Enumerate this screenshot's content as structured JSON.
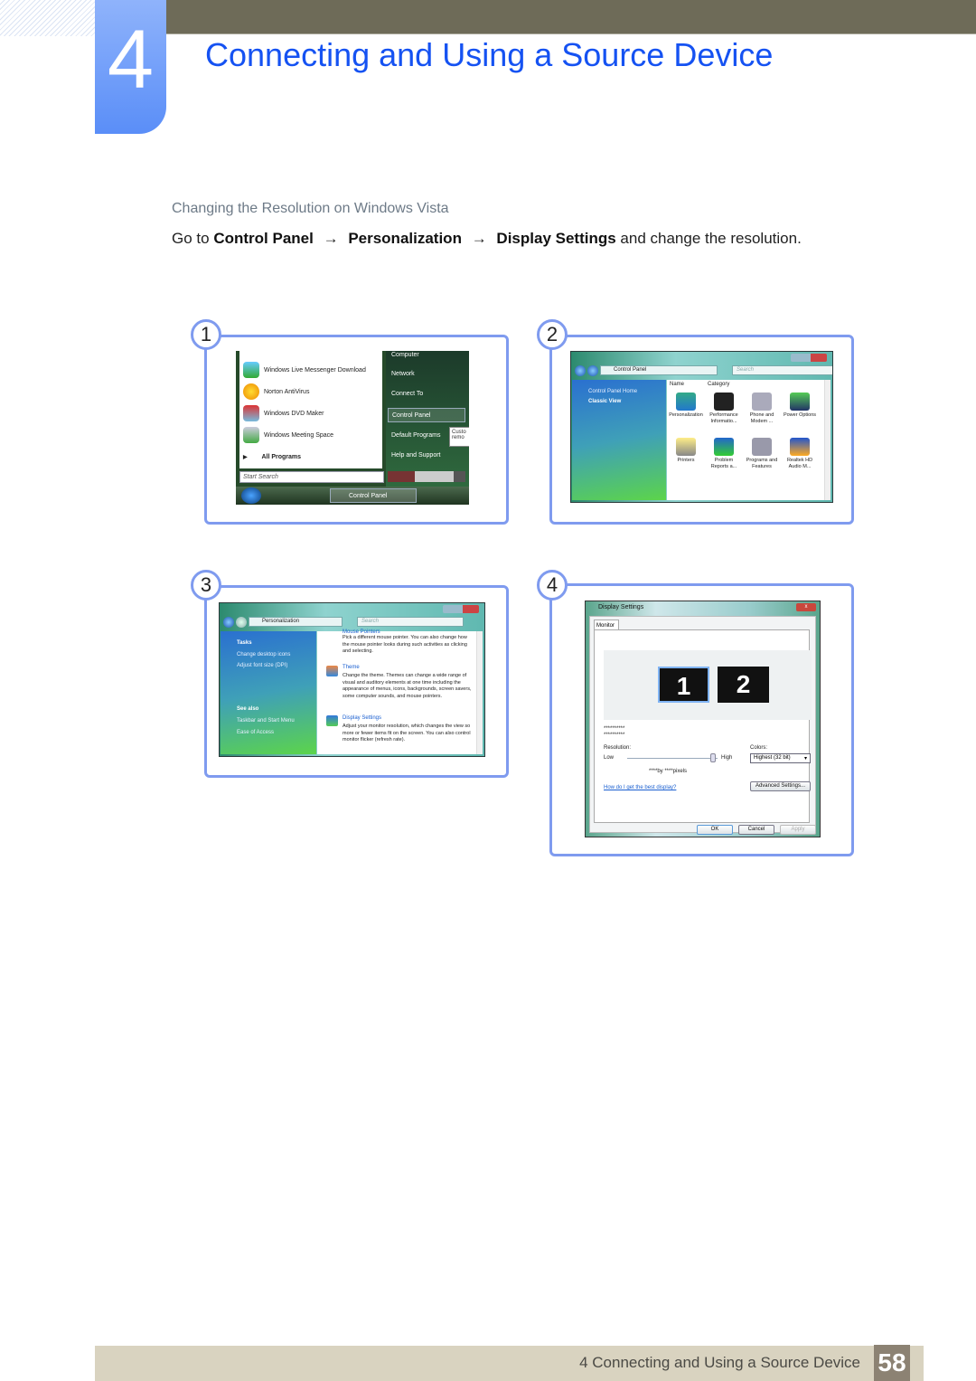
{
  "header": {
    "chapter_number": "4",
    "chapter_title": "Connecting and Using a Source Device"
  },
  "section": {
    "subheading": "Changing the Resolution on Windows Vista",
    "instruction": {
      "prefix": "Go to",
      "step1": "Control Panel",
      "arrow": "→",
      "step2": "Personalization",
      "step3": "Display Settings",
      "suffix": "and change the resolution."
    }
  },
  "steps": [
    {
      "badge": "1",
      "start_menu": {
        "left_items": [
          "Windows Live Messenger Download",
          "Norton AntiVirus",
          "Windows DVD Maker",
          "Windows Meeting Space"
        ],
        "all_programs": "All Programs",
        "right_items": [
          "Computer",
          "Network",
          "Connect To",
          "Control Panel",
          "Default Programs",
          "Help and Support"
        ],
        "selected_right_item": "Control Panel",
        "tooltip": "Custo remo",
        "search_placeholder": "Start Search",
        "taskbar_item": "Control Panel"
      }
    },
    {
      "badge": "2",
      "window": {
        "address": "Control Panel",
        "search_placeholder": "Search",
        "side_links": [
          "Control Panel Home",
          "Classic View"
        ],
        "columns": [
          "Name",
          "Category"
        ],
        "items": [
          "Personalization",
          "Performance Informatio...",
          "Phone and Modem ...",
          "Power Options",
          "Printers",
          "Problem Reports a...",
          "Programs and Features",
          "Realtek HD Audio M..."
        ]
      }
    },
    {
      "badge": "3",
      "window": {
        "address": "Personalization",
        "search_placeholder": "Search",
        "tasks_heading": "Tasks",
        "tasks": [
          "Change desktop icons",
          "Adjust font size (DPI)"
        ],
        "see_also_heading": "See also",
        "see_also": [
          "Taskbar and Start Menu",
          "Ease of Access"
        ],
        "entries": [
          {
            "title": "Mouse Pointers",
            "desc": "Pick a different mouse pointer. You can also change how the mouse pointer looks during such activities as clicking and selecting."
          },
          {
            "title": "Theme",
            "desc": "Change the theme. Themes can change a wide range of visual and auditory elements at one time including the appearance of menus, icons, backgrounds, screen savers, some computer sounds, and mouse pointers."
          },
          {
            "title": "Display Settings",
            "desc": "Adjust your monitor resolution, which changes the view so more or fewer items fit on the screen. You can also control monitor flicker (refresh rate)."
          }
        ]
      }
    },
    {
      "badge": "4",
      "dialog": {
        "title": "Display Settings",
        "close": "x",
        "tab": "Monitor",
        "monitors": [
          "1",
          "2"
        ],
        "monitor_name_line1": "**********",
        "monitor_name_line2": "**********",
        "resolution_label": "Resolution:",
        "low": "Low",
        "high": "High",
        "resolution_value": "****by ****pixels",
        "resolution_slider_fraction": 0.95,
        "colors_label": "Colors:",
        "colors_value": "Highest (32 bit)",
        "help_link": "How do I get the best display?",
        "advanced_button": "Advanced Settings...",
        "ok": "OK",
        "cancel": "Cancel",
        "apply": "Apply"
      }
    }
  ],
  "footer": {
    "text": "4 Connecting and Using a Source Device",
    "page": "58"
  },
  "colors": {
    "accent_blue": "#1552f2",
    "frame_blue": "#7f9bef",
    "topbar": "#6e6b58",
    "footer_bg": "#d9d3c0",
    "page_num_bg": "#8c8273"
  }
}
